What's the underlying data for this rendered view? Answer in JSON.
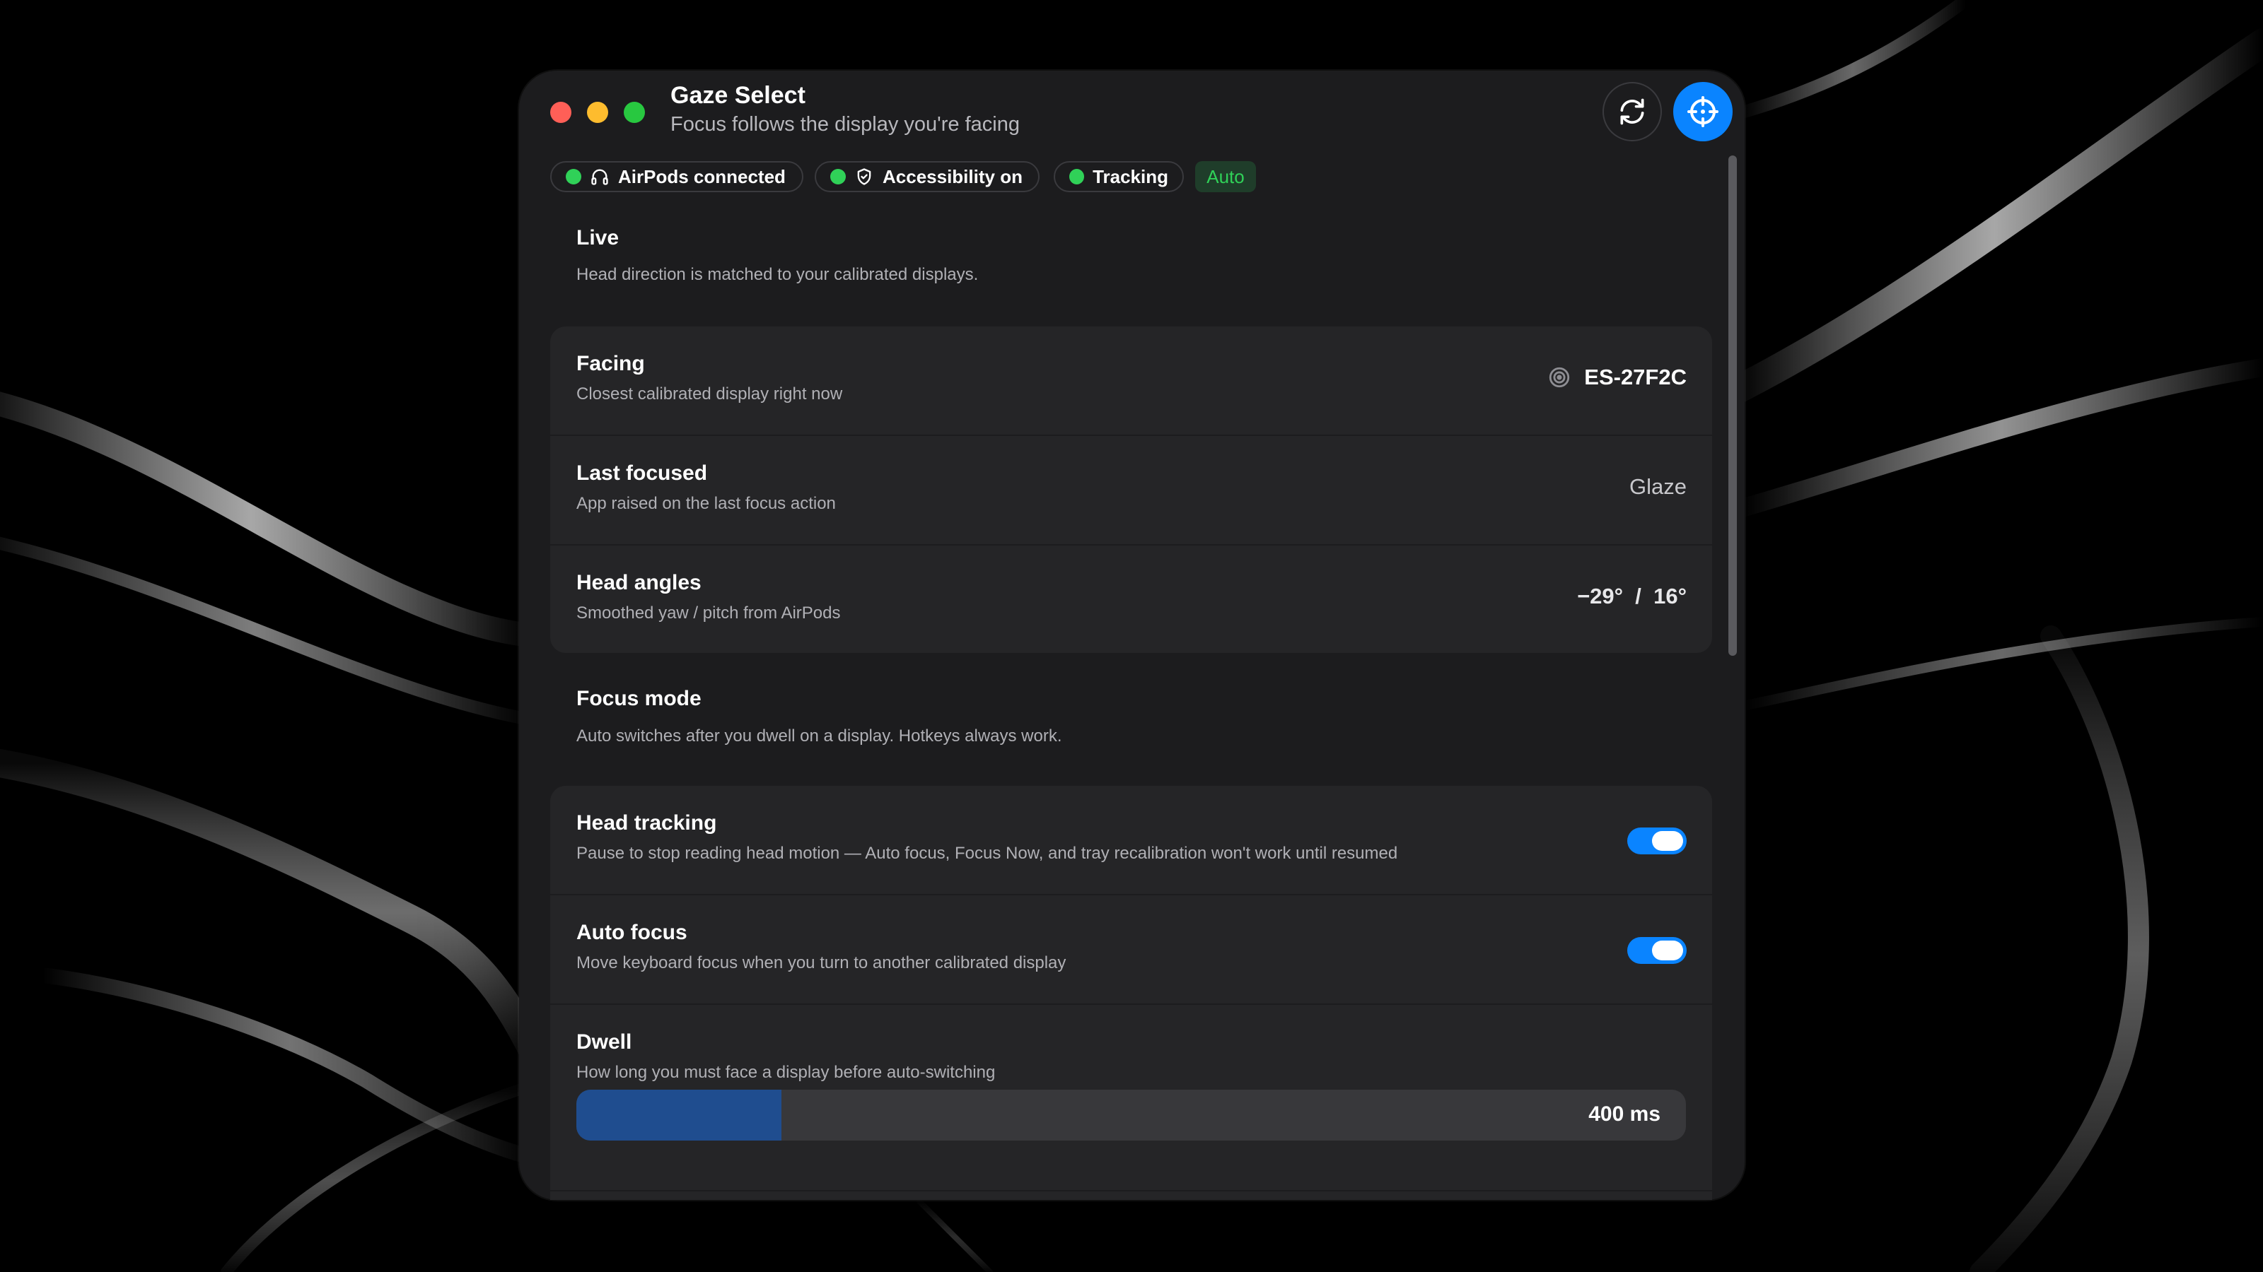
{
  "window": {
    "title": "Gaze Select",
    "subtitle": "Focus follows the display you're facing"
  },
  "header_buttons": {
    "refresh_icon": "refresh-icon",
    "target_icon": "crosshair-icon",
    "accent_color": "#0a84ff"
  },
  "status": {
    "airpods": "AirPods connected",
    "accessibility": "Accessibility on",
    "tracking": "Tracking",
    "mode": "Auto",
    "ok_color": "#30d158"
  },
  "live": {
    "title": "Live",
    "desc": "Head direction is matched to your calibrated displays."
  },
  "info_rows": {
    "facing": {
      "title": "Facing",
      "sub": "Closest calibrated display right now",
      "value": "ES-27F2C"
    },
    "last_focused": {
      "title": "Last focused",
      "sub": "App raised on the last focus action",
      "value": "Glaze"
    },
    "head_angles": {
      "title": "Head angles",
      "sub": "Smoothed yaw / pitch from AirPods",
      "value": "−29°  /  16°"
    }
  },
  "focus_mode": {
    "title": "Focus mode",
    "desc": "Auto switches after you dwell on a display. Hotkeys always work."
  },
  "settings": {
    "head_tracking": {
      "title": "Head tracking",
      "sub": "Pause to stop reading head motion — Auto focus, Focus Now, and tray recalibration won't work until resumed",
      "on": true
    },
    "auto_focus": {
      "title": "Auto focus",
      "sub": "Move keyboard focus when you turn to another calibrated display",
      "on": true
    },
    "dwell": {
      "title": "Dwell",
      "sub": "How long you must face a display before auto-switching",
      "value": "400 ms",
      "fill_fraction": 0.185
    }
  }
}
